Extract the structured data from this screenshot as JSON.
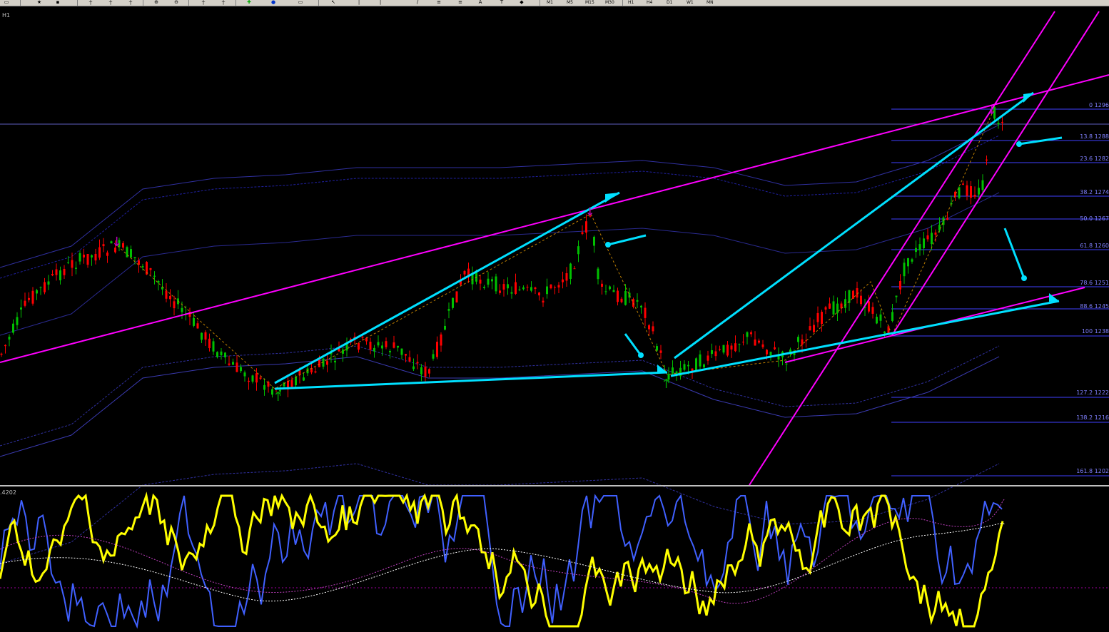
{
  "toolbar": {
    "timeframes": [
      "M1",
      "M5",
      "M15",
      "M30",
      "H1",
      "H4",
      "D1",
      "W1",
      "MN"
    ],
    "icons": [
      "new-chart-icon",
      "open-folder-icon",
      "save-icon",
      "crosshair-icon",
      "period-icon",
      "grid-icon",
      "zoom-in-icon",
      "zoom-out-icon",
      "chart-shift-icon",
      "autoscroll-icon",
      "add-indicator-icon",
      "refresh-icon",
      "image-icon",
      "cursor-icon",
      "vertical-line-icon",
      "horizontal-line-icon",
      "trendline-icon",
      "fibonacci-icon",
      "text-icon",
      "arrow-label-icon"
    ]
  },
  "chart": {
    "timeframe_label": "H1",
    "oscillator_value": ".4202",
    "fib_levels": [
      {
        "label": "0 1296"
      },
      {
        "label": "13.8 1288"
      },
      {
        "label": "23.6 1282"
      },
      {
        "label": "38.2 1274"
      },
      {
        "label": "50.0 1267"
      },
      {
        "label": "61.8 1260"
      },
      {
        "label": "78.6 1251"
      },
      {
        "label": "88.6 1245"
      },
      {
        "label": "100 1238"
      },
      {
        "label": "127.2 1222"
      },
      {
        "label": "138.2 1216"
      },
      {
        "label": "161.8 1202"
      }
    ],
    "colors": {
      "background": "#000000",
      "bull_candle": "#00c000",
      "bear_candle": "#ff0000",
      "trendline": "#00e0ff",
      "channel": "#ff00ff",
      "fib": "#4040ff",
      "oscillator_main": "#ffff00",
      "oscillator_fast": "#4060ff"
    }
  }
}
